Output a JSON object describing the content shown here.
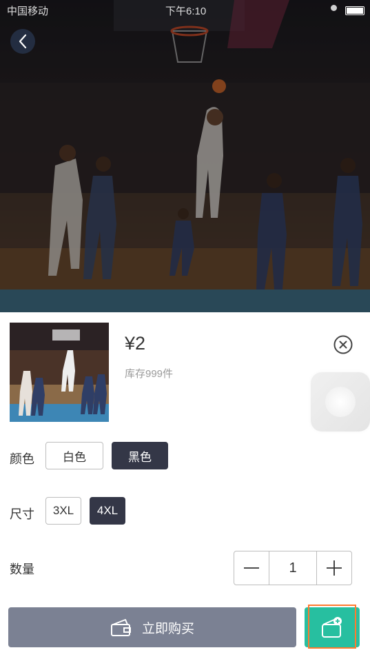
{
  "status_bar": {
    "carrier": "中国移动",
    "time": "下午6:10"
  },
  "hero": {
    "image_subject": "basketball-game-photo"
  },
  "product": {
    "price": "¥2",
    "stock": "库存999件"
  },
  "options": {
    "color": {
      "label": "颜色",
      "choices": [
        "白色",
        "黑色"
      ],
      "selected": "黑色"
    },
    "size": {
      "label": "尺寸",
      "choices": [
        "3XL",
        "4XL"
      ],
      "selected": "4XL"
    },
    "quantity": {
      "label": "数量",
      "value": "1"
    }
  },
  "actions": {
    "buy_now_label": "立即购买",
    "add_to_cart_icon": "cart-plus-icon"
  },
  "colors": {
    "selected_chip": "#343747",
    "buy_button": "#7b8193",
    "cart_button": "#27bfa0",
    "highlight": "#ff7a2e"
  }
}
